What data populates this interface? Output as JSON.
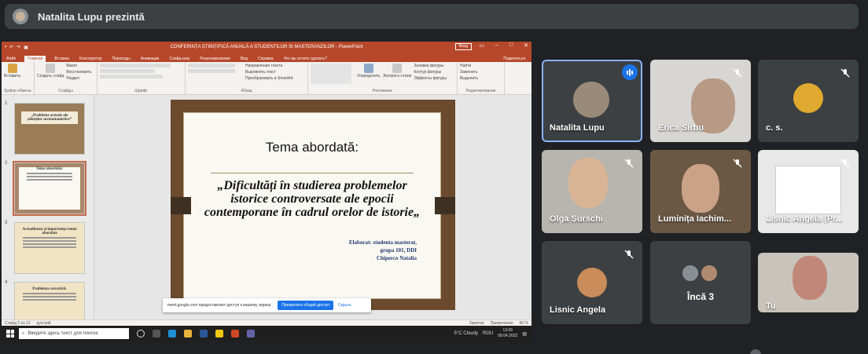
{
  "presenter_bar": {
    "title": "Natalita Lupu prezintă"
  },
  "powerpoint": {
    "doc_title": "CONFERINȚA ȘTIINȚIFICĂ ANUALĂ A STUDENȚILOR ȘI MASTERANZILOR  -  PowerPoint",
    "login": "Вход",
    "tabs": [
      "Файл",
      "Главная",
      "Вставка",
      "Конструктор",
      "Переходы",
      "Анимация",
      "Слайд-шоу",
      "Рецензирование",
      "Вид",
      "Справка",
      "Что вы хотите сделать?"
    ],
    "share": "Поделиться",
    "ribbon_groups": [
      "Буфер обмена",
      "Слайды",
      "Шрифт",
      "Абзац",
      "Рисование",
      "Редактирование"
    ],
    "ribbon_buttons": {
      "paste": "Вставить",
      "new_slide": "Создать слайд",
      "layout": "Макет",
      "reset": "Восстановить",
      "section": "Раздел",
      "arrange": "Упорядочить",
      "styles": "Экспресс-стили",
      "find": "Найти",
      "replace": "Заменить",
      "select": "Выделить"
    },
    "ribbon_text": {
      "direction": "Направление текста",
      "align": "Выровнять текст",
      "smartart": "Преобразовать в SmartArt",
      "fill": "Заливка фигуры",
      "outline": "Контур фигуры",
      "effects": "Эффекты фигуры"
    },
    "thumbnails": [
      {
        "num": "1",
        "title": "„Probleme actuale ale științelor socioumanistice”"
      },
      {
        "num": "2",
        "title": "Tema abordată:"
      },
      {
        "num": "3",
        "title": "Actualitatea și importanța temei abordate"
      },
      {
        "num": "4",
        "title": "Problema cercetării."
      }
    ],
    "slide": {
      "heading": "Tema abordată:",
      "subtitle": "„Dificultăți în studierea problemelor istorice controversate ale epocii contemporane în cadrul orelor de istorie„",
      "author_line1": "Elaborat: studenta masterat,",
      "author_line2": "grupa 101, DDI",
      "author_line3": "Chiperco Natalia"
    },
    "share_banner": {
      "text": "meet.google.com предоставляет доступ к вашему экрану.",
      "stop": "Прекратить общий доступ",
      "hide": "Скрыть"
    },
    "status": {
      "slide": "Слайд 2 из 12",
      "lang": "русский",
      "notes": "Заметки",
      "comments": "Примечания",
      "zoom": "66 %"
    },
    "taskbar": {
      "search": "Введите здесь текст для поиска",
      "weather": "5°C  Cloudy",
      "lang": "ROU",
      "time": "13:06",
      "date": "08.04.2022"
    }
  },
  "participants": [
    {
      "name": "Natalita Lupu",
      "state": "speaking"
    },
    {
      "name": "Erica Sirbu",
      "state": "muted"
    },
    {
      "name": "c. s.",
      "state": "muted"
    },
    {
      "name": "Olga Șurschi",
      "state": "muted"
    },
    {
      "name": "Luminița Iachim...",
      "state": "muted"
    },
    {
      "name": "Lisnic Angela (Pr...",
      "state": "muted"
    },
    {
      "name": "Lisnic Angela",
      "state": "muted"
    },
    {
      "name": "Încă 3",
      "state": ""
    },
    {
      "name": "Tu",
      "state": ""
    }
  ],
  "colors": {
    "meet_bg": "#202124",
    "tile_bg": "#3c4043",
    "ppt_red": "#b7472a",
    "speaking": "#1a73e8"
  }
}
